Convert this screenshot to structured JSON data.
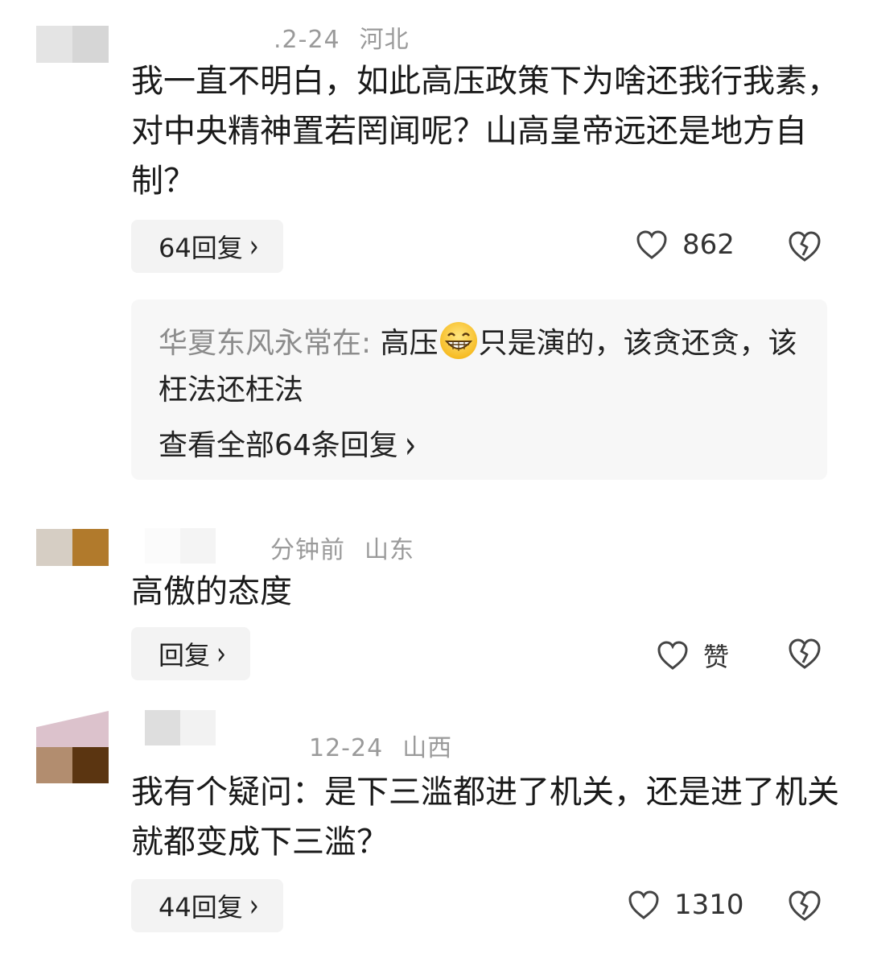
{
  "comments": [
    {
      "avatar_colors": [
        "#e2e2e2",
        "#d7d7d7"
      ],
      "date": ".2-24",
      "location": "河北",
      "text": "我一直不明白，如此高压政策下为啥还我行我素，对中央精神置若罔闻呢？山高皇帝远还是地方自制？",
      "reply_label": "64回复",
      "like_count": "862",
      "sub_reply": {
        "author": "华夏东风永常在:",
        "text_before": " 高压",
        "emoji": "grinning-face-emoji",
        "text_after": "只是演的，该贪还贪，该枉法还枉法",
        "view_all": "查看全部64条回复"
      }
    },
    {
      "avatar_colors": [
        "#d8d0c6",
        "#b07a2d"
      ],
      "date": "分钟前",
      "location": "山东",
      "text": "高傲的态度",
      "reply_label": "回复",
      "like_count": "赞"
    },
    {
      "avatar_colors": [
        "#dcc3cd",
        "#e9d6dd",
        "#b08a6c",
        "#5a3512"
      ],
      "date": "12-24",
      "location": "山西",
      "text": "我有个疑问：是下三滥都进了机关，还是进了机关就都变成下三滥？",
      "reply_label": "44回复",
      "like_count": "1310"
    }
  ],
  "icons": {
    "like": "heart-outline-icon",
    "dislike": "broken-heart-icon",
    "chevron": "chevron-right-icon"
  },
  "chevron_glyph": "›"
}
